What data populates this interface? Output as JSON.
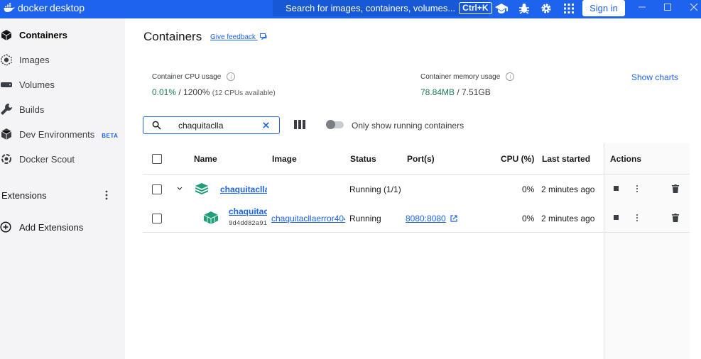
{
  "app": {
    "brand_light": "docker",
    "brand_bold": "desktop"
  },
  "titlebar": {
    "search_placeholder": "Search for images, containers, volumes...",
    "shortcut": "Ctrl+K",
    "signin_label": "Sign in",
    "accent": "#1d63ed"
  },
  "sidebar": {
    "items": [
      {
        "label": "Containers",
        "icon": "containers-icon",
        "active": true
      },
      {
        "label": "Images",
        "icon": "images-icon"
      },
      {
        "label": "Volumes",
        "icon": "volumes-icon"
      },
      {
        "label": "Builds",
        "icon": "wrench-icon"
      },
      {
        "label": "Dev Environments",
        "icon": "dev-environments-icon",
        "badge": "BETA"
      },
      {
        "label": "Docker Scout",
        "icon": "docker-scout-icon"
      }
    ],
    "extensions_label": "Extensions",
    "add_extensions_label": "Add Extensions"
  },
  "main": {
    "title": "Containers",
    "feedback_label": "Give feedback",
    "cpu": {
      "label": "Container CPU usage",
      "value": "0.01%",
      "total": "/ 1200%",
      "note": "(12 CPUs available)"
    },
    "memory": {
      "label": "Container memory usage",
      "value": "78.84MB",
      "total": "/ 7.51GB"
    },
    "show_charts_label": "Show charts",
    "filter_value": "chaquitaclla",
    "toggle_label": "Only show running containers",
    "columns": [
      "Name",
      "Image",
      "Status",
      "Port(s)",
      "CPU (%)",
      "Last started",
      "Actions"
    ],
    "rows": [
      {
        "name": "chaquitaclla",
        "image": "",
        "status": "Running (1/1)",
        "ports": "",
        "cpu": "0%",
        "last_started": "2 minutes ago"
      },
      {
        "name": "chaquitaclla",
        "id": "9d4dd82a91",
        "image": "chaquitacllaerror404",
        "status": "Running",
        "ports": "8080:8080",
        "cpu": "0%",
        "last_started": "2 minutes ago"
      }
    ]
  }
}
